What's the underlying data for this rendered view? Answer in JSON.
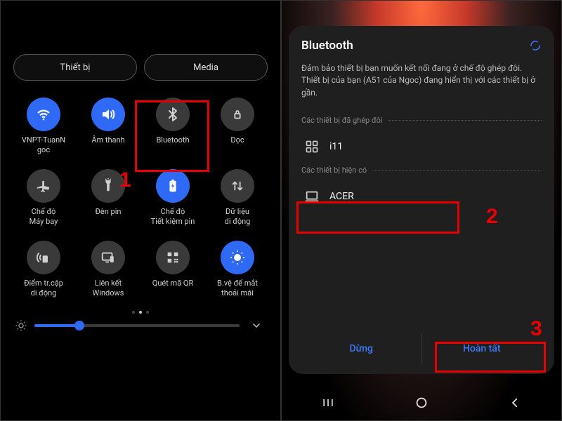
{
  "left": {
    "tabs": {
      "device": "Thiết bị",
      "media": "Media"
    },
    "tiles": [
      {
        "label": "VNPT-TuanN\ngoc"
      },
      {
        "label": "Âm thanh"
      },
      {
        "label": "Bluetooth"
      },
      {
        "label": "Dọc"
      },
      {
        "label": "Chế độ\nMáy bay"
      },
      {
        "label": "Đèn pin"
      },
      {
        "label": "Chế độ\nTiết kiệm pin"
      },
      {
        "label": "Dữ liệu\ndi động"
      },
      {
        "label": "Điểm tr.cập\ndi động"
      },
      {
        "label": "Liên kết\nWindows"
      },
      {
        "label": "Quét mã QR"
      },
      {
        "label": "B.vệ để mắt\nthoải mái"
      }
    ]
  },
  "right": {
    "title": "Bluetooth",
    "desc": "Đảm bảo thiết bị bạn muốn kết nối đang ở chế độ ghép đôi. Thiết bị của bạn (A51 của Ngoc) đang hiển thị với các thiết bị ở gần.",
    "paired_label": "Các thiết bị đã ghép đôi",
    "avail_label": "Các thiết bị hiện có",
    "paired_device": "i11",
    "avail_device": "ACER",
    "stop": "Dừng",
    "done": "Hoàn tất"
  },
  "annotations": {
    "one": "1",
    "two": "2",
    "three": "3"
  }
}
